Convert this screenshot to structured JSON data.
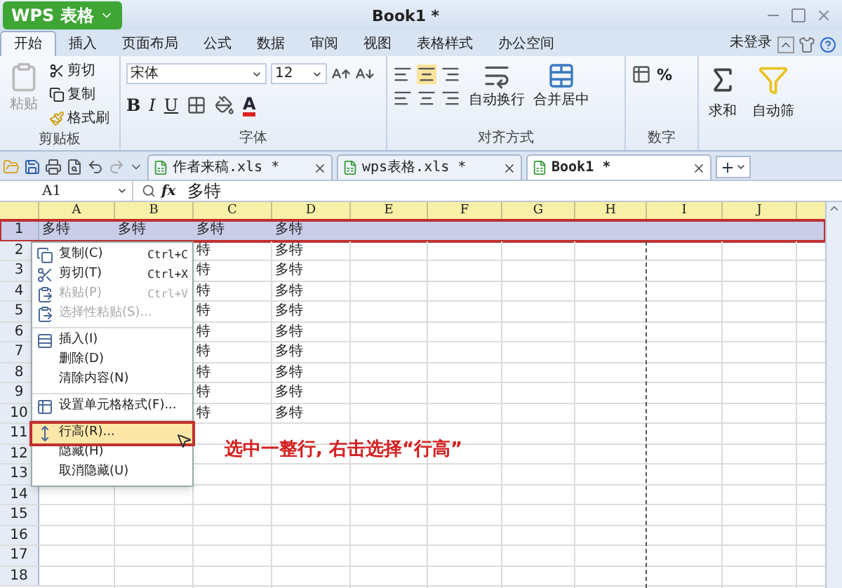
{
  "app_button": "WPS 表格",
  "title": "Book1 *",
  "menu_tabs": [
    {
      "label": "开始",
      "selected": true
    },
    {
      "label": "插入",
      "selected": false
    },
    {
      "label": "页面布局",
      "selected": false
    },
    {
      "label": "公式",
      "selected": false
    },
    {
      "label": "数据",
      "selected": false
    },
    {
      "label": "审阅",
      "selected": false
    },
    {
      "label": "视图",
      "selected": false
    },
    {
      "label": "表格样式",
      "selected": false
    },
    {
      "label": "办公空间",
      "selected": false
    }
  ],
  "login": "未登录",
  "ribbon": {
    "clipboard": {
      "label": "剪贴板",
      "paste": "粘贴",
      "cut": "剪切",
      "copy": "复制",
      "format_painter": "格式刷"
    },
    "font": {
      "label": "字体",
      "font_name": "宋体",
      "font_size": "12",
      "bold": "B",
      "italic": "I",
      "underline": "U",
      "font_color": "A"
    },
    "alignment": {
      "label": "对齐方式",
      "wrap": "自动换行",
      "merge": "合并居中"
    },
    "number": {
      "label": "数字",
      "percent": "%"
    },
    "sum": "求和",
    "filter": "自动筛"
  },
  "doc_tabs": [
    {
      "label": "作者来稿.xls *",
      "selected": false
    },
    {
      "label": "wps表格.xls *",
      "selected": false
    },
    {
      "label": "Book1 *",
      "selected": true
    }
  ],
  "name_box": "A1",
  "formula_label": "fx",
  "formula": "多特",
  "columns": [
    "A",
    "B",
    "C",
    "D",
    "E",
    "F",
    "G",
    "H",
    "I",
    "J"
  ],
  "rows": [
    {
      "number": "1",
      "selected": true,
      "cells": {
        "A": "多特",
        "B": "多特",
        "C": "多特",
        "D": "多特"
      }
    },
    {
      "number": "2",
      "selected": false,
      "cells": {
        "C": "特",
        "D": "多特"
      }
    },
    {
      "number": "3",
      "selected": false,
      "cells": {
        "C": "特",
        "D": "多特"
      }
    },
    {
      "number": "4",
      "selected": false,
      "cells": {
        "C": "特",
        "D": "多特"
      }
    },
    {
      "number": "5",
      "selected": false,
      "cells": {
        "C": "特",
        "D": "多特"
      }
    },
    {
      "number": "6",
      "selected": false,
      "cells": {
        "C": "特",
        "D": "多特"
      }
    },
    {
      "number": "7",
      "selected": false,
      "cells": {
        "C": "特",
        "D": "多特"
      }
    },
    {
      "number": "8",
      "selected": false,
      "cells": {
        "C": "特",
        "D": "多特"
      }
    },
    {
      "number": "9",
      "selected": false,
      "cells": {
        "C": "特",
        "D": "多特"
      }
    },
    {
      "number": "10",
      "selected": false,
      "cells": {
        "C": "特",
        "D": "多特"
      }
    },
    {
      "number": "11",
      "selected": false
    },
    {
      "number": "12",
      "selected": false
    },
    {
      "number": "13",
      "selected": false
    },
    {
      "number": "14",
      "selected": false
    },
    {
      "number": "15",
      "selected": false
    },
    {
      "number": "16",
      "selected": false
    },
    {
      "number": "17",
      "selected": false
    },
    {
      "number": "18",
      "selected": false
    }
  ],
  "context_menu": [
    [
      {
        "label": "复制(C)",
        "shortcut": "Ctrl+C",
        "kind": "copy",
        "disabled": false,
        "selected": false
      },
      {
        "label": "剪切(T)",
        "shortcut": "Ctrl+X",
        "kind": "cut",
        "disabled": false,
        "selected": false
      },
      {
        "label": "粘贴(P)",
        "shortcut": "Ctrl+V",
        "kind": "paste",
        "disabled": true,
        "selected": false
      },
      {
        "label": "选择性粘贴(S)...",
        "kind": "paste",
        "disabled": true,
        "selected": false
      }
    ],
    [
      {
        "label": "插入(I)",
        "kind": "insert",
        "disabled": false,
        "selected": false
      },
      {
        "label": "删除(D)",
        "kind": "plain",
        "disabled": false,
        "selected": false
      },
      {
        "label": "清除内容(N)",
        "kind": "plain",
        "disabled": false,
        "selected": false
      }
    ],
    [
      {
        "label": "设置单元格格式(F)...",
        "kind": "format",
        "disabled": false,
        "selected": false
      }
    ],
    [
      {
        "label": "行高(R)...",
        "kind": "row-height",
        "disabled": false,
        "selected": true
      },
      {
        "label": "隐藏(H)",
        "kind": "plain",
        "disabled": false,
        "selected": false
      },
      {
        "label": "取消隐藏(U)",
        "kind": "plain",
        "disabled": false,
        "selected": false
      }
    ]
  ],
  "annotation": "选中一整行, 右击选择“行高”"
}
